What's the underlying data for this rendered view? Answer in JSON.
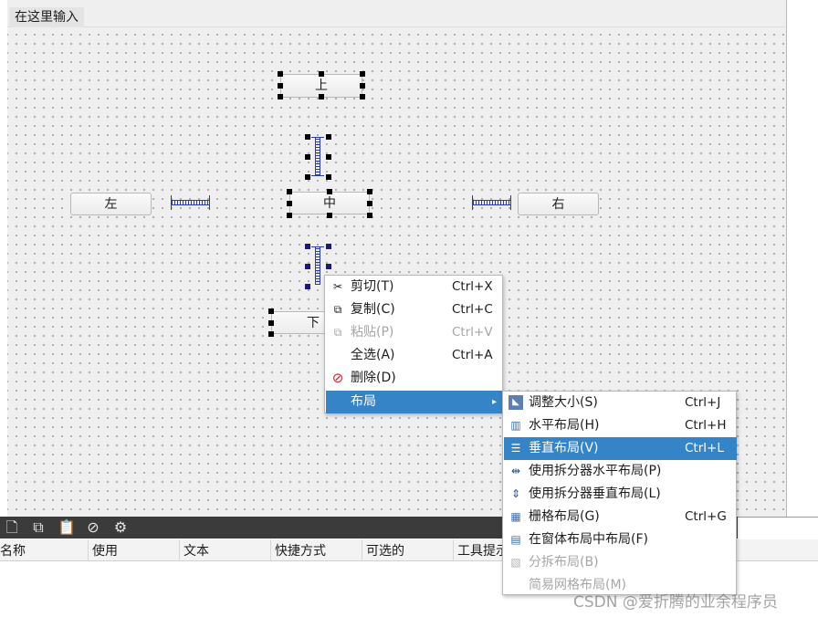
{
  "menubar": {
    "placeholder_item": "在这里输入"
  },
  "form": {
    "buttons": {
      "top": "上",
      "center": "中",
      "left": "左",
      "right": "右",
      "bottom": "下"
    }
  },
  "context_menu": {
    "items": [
      {
        "label": "剪切(T)",
        "shortcut": "Ctrl+X",
        "icon": "scissors-icon",
        "enabled": true
      },
      {
        "label": "复制(C)",
        "shortcut": "Ctrl+C",
        "icon": "copy-icon",
        "enabled": true
      },
      {
        "label": "粘贴(P)",
        "shortcut": "Ctrl+V",
        "icon": "paste-icon",
        "enabled": false
      },
      {
        "label": "全选(A)",
        "shortcut": "Ctrl+A",
        "icon": "",
        "enabled": true
      },
      {
        "label": "删除(D)",
        "shortcut": "",
        "icon": "delete-icon",
        "enabled": true
      },
      {
        "label": "布局",
        "shortcut": "",
        "icon": "",
        "enabled": true,
        "submenu": true,
        "highlighted": true
      }
    ]
  },
  "layout_submenu": {
    "items": [
      {
        "label": "调整大小(S)",
        "shortcut": "Ctrl+J",
        "icon": "adjust-size-icon",
        "enabled": true
      },
      {
        "label": "水平布局(H)",
        "shortcut": "Ctrl+H",
        "icon": "horizontal-layout-icon",
        "enabled": true
      },
      {
        "label": "垂直布局(V)",
        "shortcut": "Ctrl+L",
        "icon": "vertical-layout-icon",
        "enabled": true,
        "highlighted": true
      },
      {
        "label": "使用拆分器水平布局(P)",
        "shortcut": "",
        "icon": "horizontal-splitter-icon",
        "enabled": true
      },
      {
        "label": "使用拆分器垂直布局(L)",
        "shortcut": "",
        "icon": "vertical-splitter-icon",
        "enabled": true
      },
      {
        "label": "栅格布局(G)",
        "shortcut": "Ctrl+G",
        "icon": "grid-layout-icon",
        "enabled": true
      },
      {
        "label": "在窗体布局中布局(F)",
        "shortcut": "",
        "icon": "form-layout-icon",
        "enabled": true
      },
      {
        "label": "分拆布局(B)",
        "shortcut": "",
        "icon": "break-layout-icon",
        "enabled": false
      },
      {
        "label": "简易网格布局(M)",
        "shortcut": "",
        "icon": "",
        "enabled": false
      }
    ]
  },
  "action_editor": {
    "toolbar_icons": [
      "new-action-icon",
      "copy-action-icon",
      "paste-action-icon",
      "delete-action-icon",
      "settings-icon"
    ],
    "columns": [
      "名称",
      "使用",
      "文本",
      "快捷方式",
      "可选的",
      "工具提示"
    ]
  },
  "watermark": "CSDN @爱折腾的业余程序员",
  "colors": {
    "selection": "#3584c8",
    "spacer": "#2a3aaa",
    "canvas": "#efefef"
  }
}
